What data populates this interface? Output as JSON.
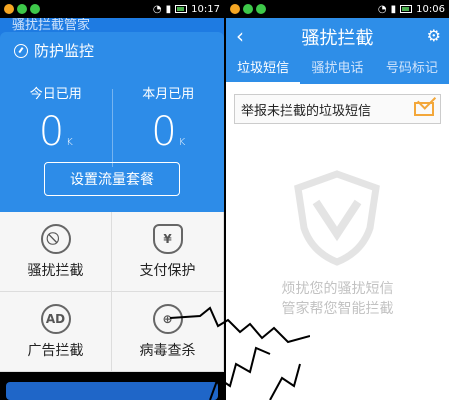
{
  "left_status": {
    "time": "10:17"
  },
  "right_status": {
    "time": "10:06"
  },
  "left": {
    "underbar_title": "骚扰拦截管家",
    "panel_title": "防护监控",
    "today_label": "今日已用",
    "today_value": "0",
    "today_unit": "K",
    "month_label": "本月已用",
    "month_value": "0",
    "month_unit": "K",
    "set_plan_button": "设置流量套餐",
    "features": [
      {
        "label": "骚扰拦截",
        "icon": "no-phone-icon"
      },
      {
        "label": "支付保护",
        "icon": "shield-yen-icon"
      },
      {
        "label": "广告拦截",
        "icon": "ad-block-icon"
      },
      {
        "label": "病毒查杀",
        "icon": "target-icon"
      }
    ]
  },
  "right": {
    "header_title": "骚扰拦截",
    "tabs": [
      "垃圾短信",
      "骚扰电话",
      "号码标记"
    ],
    "report_text": "举报未拦截的垃圾短信",
    "empty_line1": "烦扰您的骚扰短信",
    "empty_line2": "管家帮您智能拦截"
  },
  "colors": {
    "accent": "#2e8ee8",
    "panel": "#2d8ce8",
    "envelope": "#f3a73a"
  }
}
